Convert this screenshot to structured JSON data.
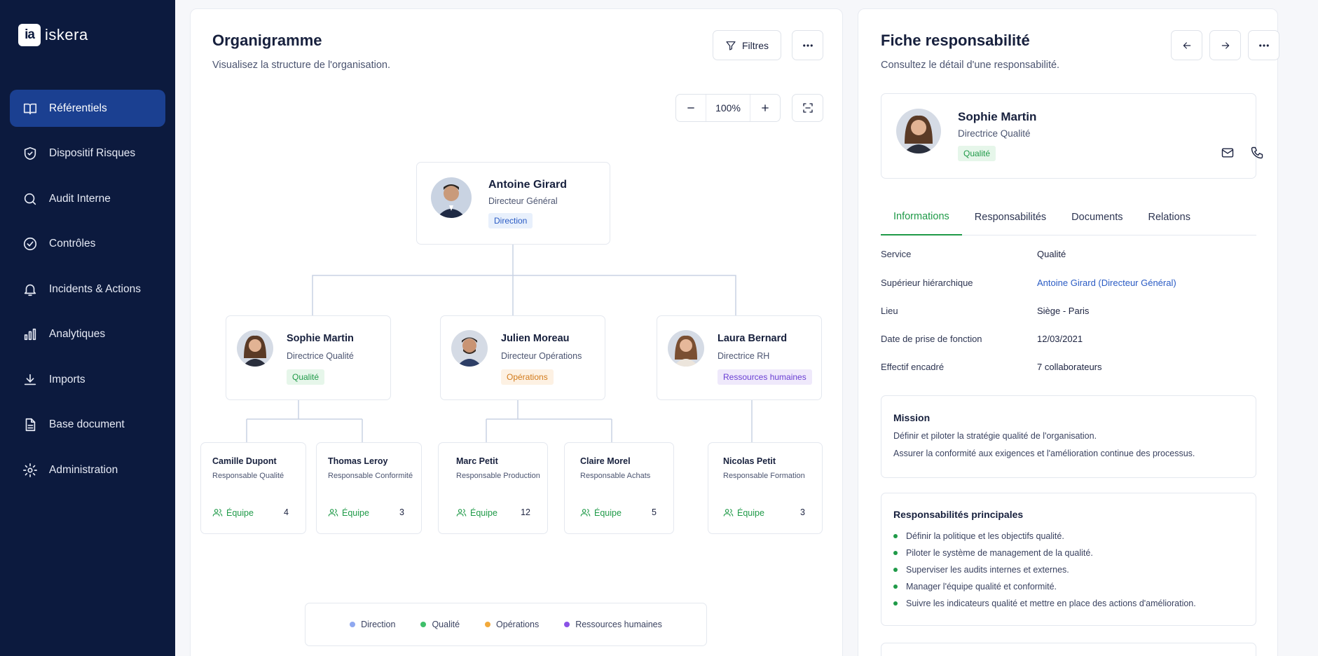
{
  "app": {
    "logo_mark": "ia",
    "logo_text": "iskera"
  },
  "sidebar": {
    "items": [
      {
        "label": "Référentiels",
        "icon": "book-icon",
        "active": true
      },
      {
        "label": "Dispositif Risques",
        "icon": "shield-icon"
      },
      {
        "label": "Audit Interne",
        "icon": "search-icon"
      },
      {
        "label": "Contrôles",
        "icon": "check-circle-icon"
      },
      {
        "label": "Incidents & Actions",
        "icon": "bell-icon"
      },
      {
        "label": "Analytiques",
        "icon": "bar-chart-icon"
      },
      {
        "label": "Imports",
        "icon": "download-icon"
      },
      {
        "label": "Base document",
        "icon": "document-icon"
      },
      {
        "label": "Administration",
        "icon": "gear-icon"
      }
    ]
  },
  "org": {
    "title": "Organigramme",
    "subtitle": "Visualisez la structure de l'organisation.",
    "filters_label": "Filtres",
    "zoom": "100%",
    "root": {
      "name": "Antoine Girard",
      "role": "Directeur Général",
      "tag": "Direction"
    },
    "managers": [
      {
        "name": "Sophie Martin",
        "role": "Directrice Qualité",
        "tag": "Qualité"
      },
      {
        "name": "Julien Moreau",
        "role": "Directeur Opérations",
        "tag": "Opérations"
      },
      {
        "name": "Laura Bernard",
        "role": "Directrice RH",
        "tag": "Ressources humaines"
      }
    ],
    "team_label": "Équipe",
    "members": [
      {
        "name": "Camille Dupont",
        "role": "Responsable Qualité",
        "count": "4"
      },
      {
        "name": "Thomas Leroy",
        "role": "Responsable Conformité",
        "count": "3"
      },
      {
        "name": "Marc Petit",
        "role": "Responsable Production",
        "count": "12"
      },
      {
        "name": "Claire Morel",
        "role": "Responsable Achats",
        "count": "5"
      },
      {
        "name": "Nicolas Petit",
        "role": "Responsable Formation",
        "count": "3"
      }
    ],
    "legend": [
      {
        "label": "Direction",
        "color": "#8fa8f0"
      },
      {
        "label": "Qualité",
        "color": "#3fbf6a"
      },
      {
        "label": "Opérations",
        "color": "#f2a93b"
      },
      {
        "label": "Ressources humaines",
        "color": "#8a52e6"
      }
    ]
  },
  "fiche": {
    "title": "Fiche responsabilité",
    "subtitle": "Consultez le détail d'une responsabilité.",
    "person": {
      "name": "Sophie Martin",
      "role": "Directrice Qualité",
      "tag": "Qualité"
    },
    "tabs": [
      "Informations",
      "Responsabilités",
      "Documents",
      "Relations"
    ],
    "info": [
      {
        "label": "Service",
        "value": "Qualité"
      },
      {
        "label": "Supérieur hiérarchique",
        "value": "Antoine Girard (Directeur Général)"
      },
      {
        "label": "Lieu",
        "value": "Siège - Paris"
      },
      {
        "label": "Date de prise de fonction",
        "value": "12/03/2021"
      },
      {
        "label": "Effectif encadré",
        "value": "7 collaborateurs"
      }
    ],
    "mission": {
      "title": "Mission",
      "lines": [
        "Définir et piloter la stratégie qualité de l'organisation.",
        "Assurer la conformité aux exigences et l'amélioration continue des processus."
      ]
    },
    "responsibilities": {
      "title": "Responsabilités principales",
      "items": [
        "Définir la politique et les objectifs qualité.",
        "Piloter le système de management de la qualité.",
        "Superviser les audits internes et externes.",
        "Manager l'équipe qualité et conformité.",
        "Suivre les indicateurs qualité et mettre en place des actions d'amélioration."
      ]
    }
  }
}
